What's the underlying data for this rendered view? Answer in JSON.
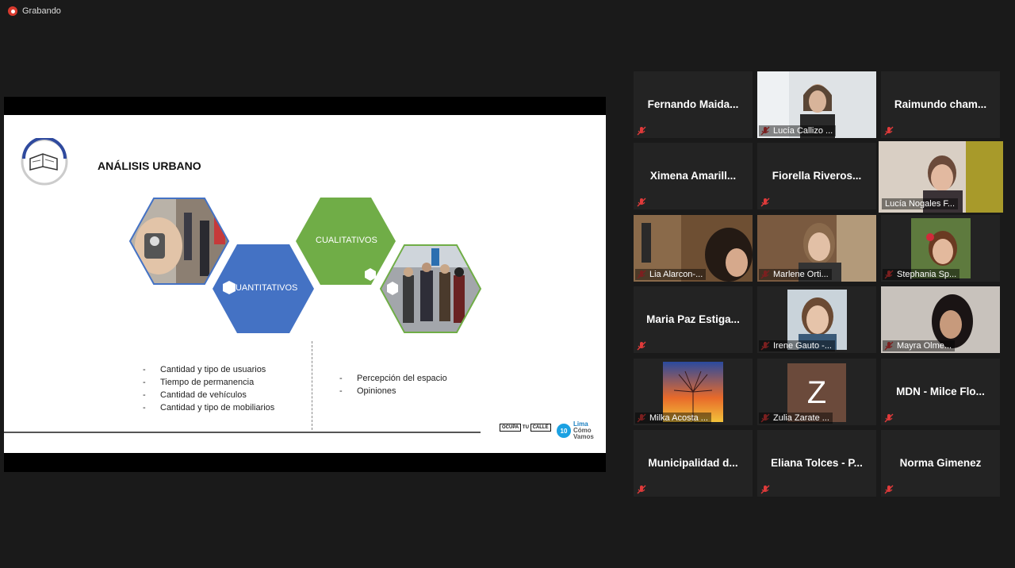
{
  "recording": {
    "label": "Grabando"
  },
  "slide": {
    "title": "ANÁLISIS URBANO",
    "hex_quantitative": "CUANTITATIVOS",
    "hex_qualitative": "CUALITATIVOS",
    "left_bullets": [
      {
        "dash": "-",
        "text": "Cantidad y tipo de usuarios"
      },
      {
        "dash": "-",
        "text": "Tiempo de permanencia"
      },
      {
        "dash": "-",
        "text": "Cantidad de vehículos"
      },
      {
        "dash": "-",
        "text": "Cantidad y tipo de mobiliarios"
      }
    ],
    "right_bullets": [
      {
        "dash": "-",
        "text": "Percepción del espacio"
      },
      {
        "dash": "-",
        "text": "Opiniones"
      }
    ],
    "ocupa_logo": {
      "a": "OCUPA",
      "b": "TU",
      "c": "CALLE"
    },
    "lima_logo": {
      "badge": "10",
      "line1": "Lima",
      "line2": "Cómo",
      "line3": "Vamos"
    },
    "colors": {
      "blue": "#4472c4",
      "green": "#70ad47"
    }
  },
  "participants": [
    {
      "name": "Fernando  Maida...",
      "video": false
    },
    {
      "name": "Lucía Callizo ...",
      "video": true
    },
    {
      "name": "Raimundo  cham...",
      "video": false
    },
    {
      "name": "Ximena  Amarill...",
      "video": false
    },
    {
      "name": "Fiorella  Riveros...",
      "video": false
    },
    {
      "name": "Lucía Nogales F...",
      "video": true,
      "active": true
    },
    {
      "name": "Lia Alarcon-...",
      "video": true
    },
    {
      "name": "Marlene Orti...",
      "video": true
    },
    {
      "name": "Stephania Sp...",
      "video": true
    },
    {
      "name": "Maria Paz  Estiga...",
      "video": false
    },
    {
      "name": "Irene Gauto -...",
      "video": true
    },
    {
      "name": "Mayra Olme...",
      "video": true
    },
    {
      "name": "Milka Acosta ...",
      "video": true
    },
    {
      "name": "Zulia Zarate ...",
      "video": true,
      "avatar_letter": "Z"
    },
    {
      "name": "MDN  -  Milce  Flo...",
      "video": false
    },
    {
      "name": "Municipalidad  d...",
      "video": false
    },
    {
      "name": "Eliana  Tolces  -  P...",
      "video": false
    },
    {
      "name": "Norma Gimenez",
      "video": false
    }
  ]
}
